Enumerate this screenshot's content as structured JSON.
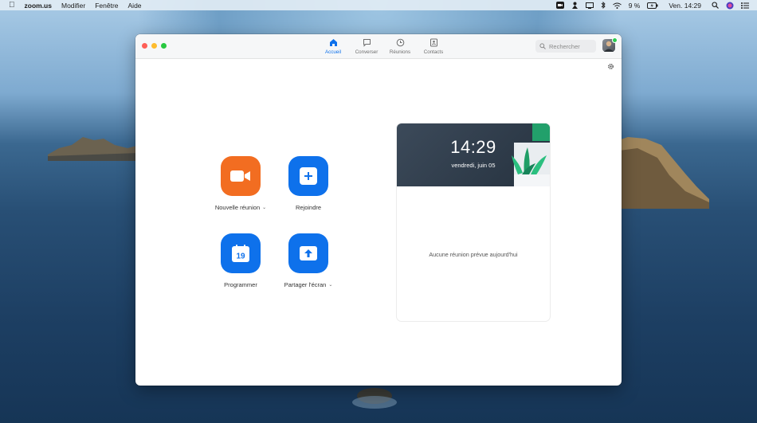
{
  "menubar": {
    "app_name": "zoom.us",
    "menus": [
      "Modifier",
      "Fenêtre",
      "Aide"
    ],
    "battery": "9 %",
    "clock": "Ven. 14:29"
  },
  "tabs": [
    {
      "label": "Accueil",
      "icon": "home-icon",
      "active": true
    },
    {
      "label": "Converser",
      "icon": "chat-icon",
      "active": false
    },
    {
      "label": "Réunions",
      "icon": "clock-icon",
      "active": false
    },
    {
      "label": "Contacts",
      "icon": "contacts-icon",
      "active": false
    }
  ],
  "search": {
    "placeholder": "Rechercher"
  },
  "actions": {
    "new_meeting": "Nouvelle réunion",
    "join": "Rejoindre",
    "schedule": "Programmer",
    "schedule_day": "19",
    "share_screen": "Partager l'écran"
  },
  "calendar": {
    "time": "14:29",
    "date": "vendredi, juin 05",
    "empty_text": "Aucune réunion prévue aujourd'hui"
  },
  "colors": {
    "accent_blue": "#0e71eb",
    "accent_orange": "#f26d21",
    "online_green": "#2ccb50"
  }
}
